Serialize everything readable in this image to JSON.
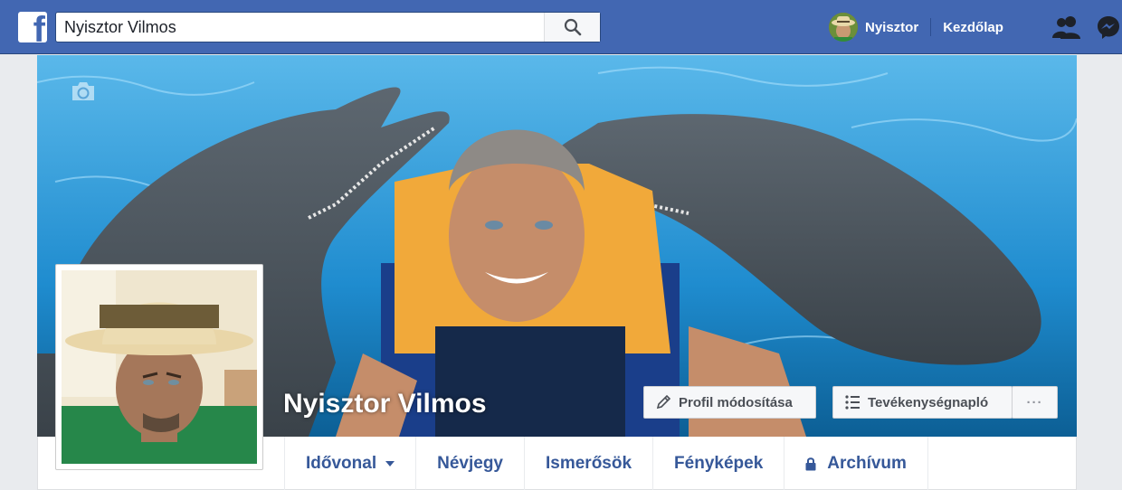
{
  "topbar": {
    "logo": "facebook-logo",
    "search_value": "Nyisztor Vilmos",
    "user_name": "Nyisztor",
    "home_label": "Kezdőlap",
    "icons": [
      "search-icon",
      "friends-icon",
      "messenger-icon"
    ]
  },
  "profile": {
    "name": "Nyisztor Vilmos"
  },
  "cover_actions": {
    "edit_label": "Profil módosítása",
    "activity_label": "Tevékenységnapló",
    "more_label": "···"
  },
  "tabs": [
    {
      "label": "Idővonal"
    },
    {
      "label": "Névjegy"
    },
    {
      "label": "Ismerősök"
    },
    {
      "label": "Fényképek"
    },
    {
      "label": "Archívum"
    }
  ],
  "colors": {
    "brand": "#4267b2",
    "link": "#365899",
    "background": "#e9ebee"
  }
}
